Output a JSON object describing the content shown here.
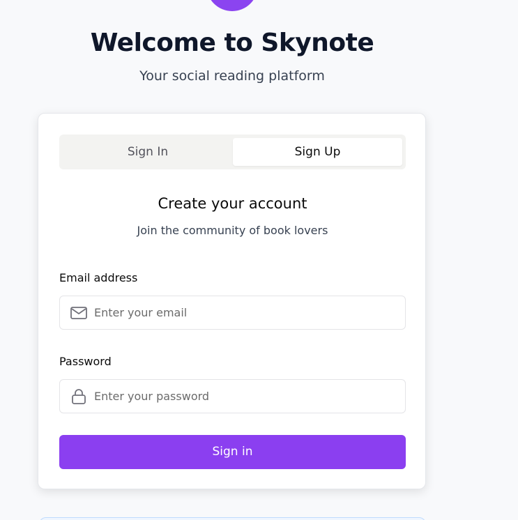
{
  "header": {
    "title": "Welcome to Skynote",
    "subtitle": "Your social reading platform"
  },
  "auth_card": {
    "tabs": [
      {
        "label": "Sign In",
        "active": false
      },
      {
        "label": "Sign Up",
        "active": true
      }
    ],
    "heading": "Create your account",
    "subheading": "Join the community of book lovers",
    "email": {
      "label": "Email address",
      "placeholder": "Enter your email",
      "value": "",
      "icon": "mail-icon"
    },
    "password": {
      "label": "Password",
      "placeholder": "Enter your password",
      "value": "",
      "icon": "lock-icon"
    },
    "submit_label": "Sign in"
  },
  "colors": {
    "accent": "#8b3ff0",
    "logo": "#8b44f0",
    "background": "#f8f9fb"
  }
}
